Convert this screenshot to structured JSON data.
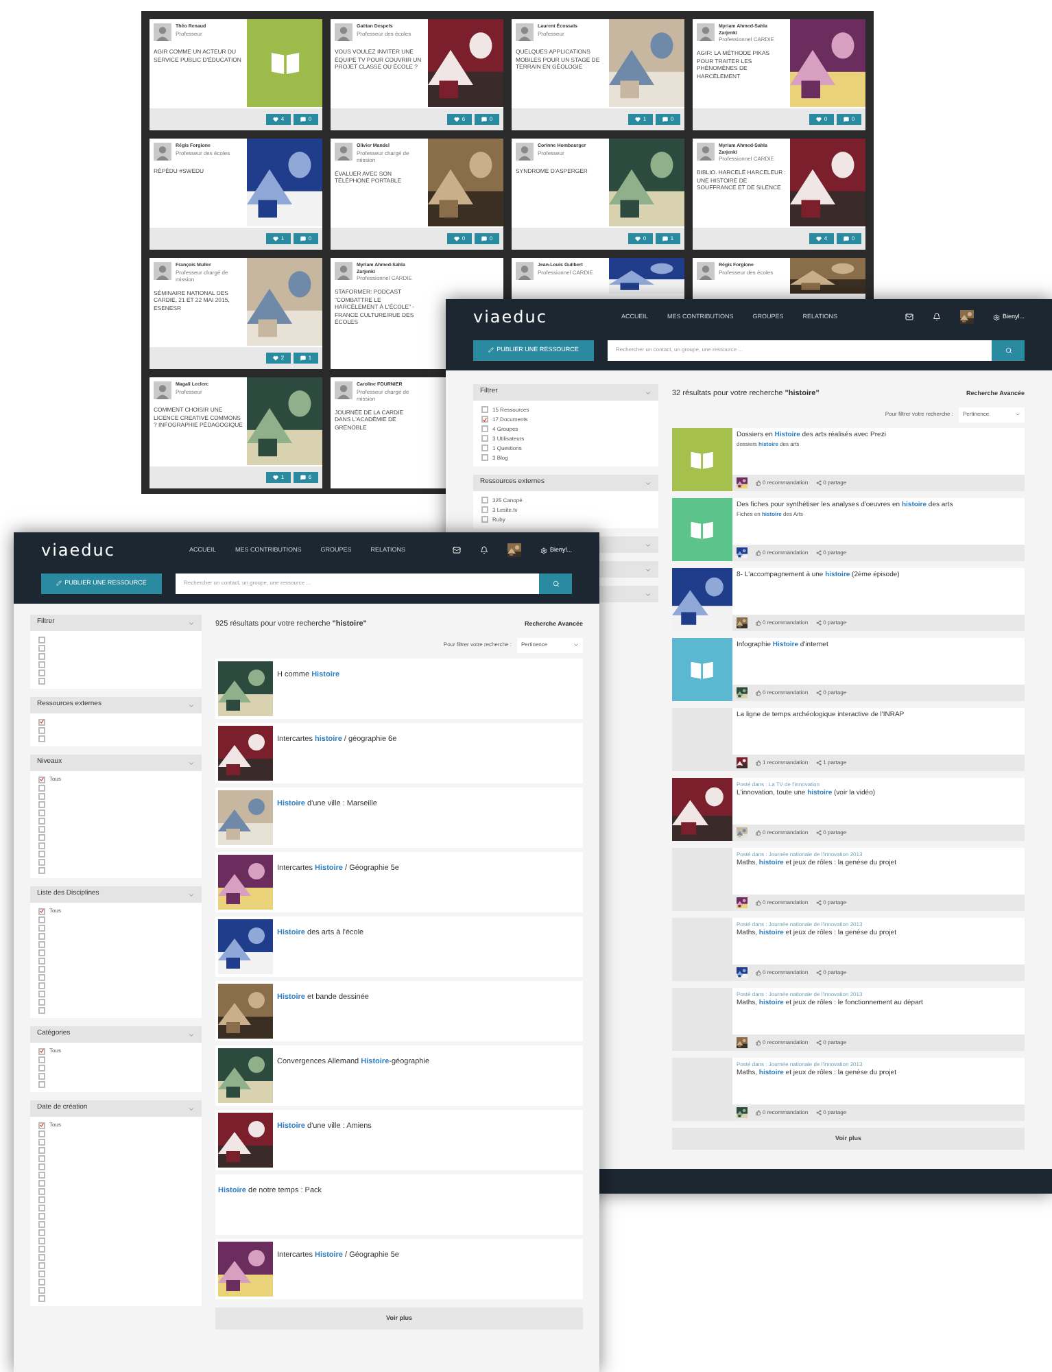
{
  "board": {
    "tiles": [
      {
        "author": "Théo Renaud",
        "role": "Professeur",
        "title": "AGIR COMME UN ACTEUR DU SERVICE PUBLIC D'ÉDUCATION",
        "thumb": {
          "kind": "book",
          "color": "#9dbb4a"
        },
        "likes": "4",
        "comments": "0"
      },
      {
        "author": "Gaëtan Despels",
        "role": "Professeur des écoles",
        "title": "VOUS VOULEZ INVITER UNE ÉQUIPE TV POUR COUVRIR UN PROJET CLASSE OU ÉCOLE ?",
        "thumb": {
          "kind": "picture"
        },
        "likes": "6",
        "comments": "0"
      },
      {
        "author": "Laurent Écossais",
        "role": "Professeur",
        "title": "QUELQUES APPLICATIONS MOBILES POUR UN STAGE DE TERRAIN EN GÉOLOGIE",
        "thumb": {
          "kind": "picture"
        },
        "likes": "1",
        "comments": "0"
      },
      {
        "author": "Myriam Ahmed-Sahla Zarjenki",
        "role": "Professionnel CARDIE",
        "title": "AGIR: LA MÉTHODE PIKAS POUR TRAITER LES PHÉNOMÈNES DE HARCÈLEMENT",
        "thumb": {
          "kind": "picture"
        },
        "likes": "0",
        "comments": "0"
      },
      {
        "author": "Régis Forgione",
        "role": "Professeur des écoles",
        "title": "RÉPÉDU #SWEDU",
        "thumb": {
          "kind": "picture"
        },
        "likes": "1",
        "comments": "0"
      },
      {
        "author": "Olivier Mandel",
        "role": "Professeur chargé de mission",
        "title": "ÉVALUER AVEC SON TÉLÉPHONE PORTABLE",
        "thumb": {
          "kind": "picture"
        },
        "likes": "0",
        "comments": "0"
      },
      {
        "author": "Corinne Hombourger",
        "role": "Professeur",
        "title": "SYNDROME D'ASPERGER",
        "thumb": {
          "kind": "picture"
        },
        "likes": "0",
        "comments": "1"
      },
      {
        "author": "Myriam Ahmed-Sahla Zarjenki",
        "role": "Professionnel CARDIE",
        "title": "BIBLIO. HARCELÉ HARCELEUR : UNE HISTOIRE DE SOUFFRANCE ET DE SILENCE",
        "thumb": {
          "kind": "picture"
        },
        "likes": "4",
        "comments": "0"
      },
      {
        "author": "François Muller",
        "role": "Professeur chargé de mission",
        "title": "SÉMINAIRE NATIONAL DES CARDIE, 21 ET 22 MAI 2015, ESENESR",
        "thumb": {
          "kind": "picture"
        },
        "likes": "2",
        "comments": "1"
      },
      {
        "author": "Myriam Ahmed-Sahla Zarjenki",
        "role": "Professionnel CARDIE",
        "title": "STAFORMER: PODCAST \"COMBATTRE LE HARCÈLEMENT À L'ÉCOLE\" - FRANCE CULTURE/RUE DES ÉCOLES"
      },
      {
        "author": "Jean-Louis Guilbert",
        "role": "Professionnel CARDIE",
        "thumb": {
          "kind": "picture"
        }
      },
      {
        "author": "Régis Forgione",
        "role": "Professeur des écoles",
        "thumb": {
          "kind": "picture"
        }
      },
      {
        "author": "Magali Leclerc",
        "role": "Professeur",
        "title": "COMMENT CHOISIR UNE LICENCE CREATIVE COMMONS ? INFOGRAPHIE PÉDAGOGIQUE",
        "thumb": {
          "kind": "picture"
        },
        "likes": "1",
        "comments": "6"
      },
      {
        "author": "Caroline FOURNIER",
        "role": "Professeur chargé de mission",
        "title": "JOURNÉE DE LA CARDIE DANS L'ACADÉMIE DE GRENOBLE"
      }
    ]
  },
  "results_page": {
    "header": {
      "logo": "viaeduc",
      "nav": [
        "ACCUEIL",
        "MES CONTRIBUTIONS",
        "GROUPES",
        "RELATIONS"
      ],
      "user": "Bienyl...",
      "publish": "PUBLIER UNE RESSOURCE",
      "search_placeholder": "Rechercher un contact, un groupe, une ressource ..."
    },
    "filter_groups": [
      {
        "title": "Filtrer",
        "items": [
          {
            "label": "15 Ressources",
            "checked": false
          },
          {
            "label": "17 Documents",
            "checked": true
          },
          {
            "label": "4 Groupes",
            "checked": false
          },
          {
            "label": "3 Utilisateurs",
            "checked": false
          },
          {
            "label": "1 Questions",
            "checked": false
          },
          {
            "label": "3 Blog",
            "checked": false
          }
        ]
      },
      {
        "title": "Ressources externes",
        "items": [
          {
            "label": "325 Canopé",
            "checked": false
          },
          {
            "label": "3 Lesite.tv",
            "checked": false
          },
          {
            "label": "Ruby",
            "checked": false
          }
        ]
      },
      {
        "expanded": false
      },
      {
        "expanded": false
      },
      {
        "expanded": false
      }
    ],
    "summary": "32 résultats pour votre recherche **\"histoire\"**",
    "advanced": "Recherche Avancée",
    "sort_label": "Pour filtrer votre recherche :",
    "sort_value": "Pertinence",
    "results": [
      {
        "title": [
          {
            "text": "Dossiers en ",
            "highlight": false
          },
          {
            "text": "Histoire",
            "highlight": true
          },
          {
            "text": " des arts réalisés avec Prezi",
            "highlight": false
          }
        ],
        "subtitle": [
          {
            "text": "dossiers ",
            "highlight": false
          },
          {
            "text": "histoire",
            "highlight": true
          },
          {
            "text": " des arts",
            "highlight": false
          }
        ],
        "thumb": {
          "kind": "book",
          "color": "#a5c04c"
        },
        "recommendations": "0 recommandation",
        "shares": "0 partage"
      },
      {
        "title": [
          {
            "text": "Des fiches pour synthétiser les analyses d'oeuvres en ",
            "highlight": false
          },
          {
            "text": "histoire",
            "highlight": true
          },
          {
            "text": " des arts",
            "highlight": false
          }
        ],
        "subtitle": [
          {
            "text": "Fiches en ",
            "highlight": false
          },
          {
            "text": "histoire",
            "highlight": true
          },
          {
            "text": " des Arts",
            "highlight": false
          }
        ],
        "thumb": {
          "kind": "book",
          "color": "#5cc48a"
        },
        "recommendations": "0 recommandation",
        "shares": "0 partage"
      },
      {
        "title": [
          {
            "text": "8- L'accompagnement à une ",
            "highlight": false
          },
          {
            "text": "histoire",
            "highlight": true
          },
          {
            "text": " (2ème épisode)",
            "highlight": false
          }
        ],
        "thumb": {
          "kind": "picture"
        },
        "recommendations": "0 recommandation",
        "shares": "0 partage"
      },
      {
        "title": [
          {
            "text": "Infographie ",
            "highlight": false
          },
          {
            "text": "Histoire",
            "highlight": true
          },
          {
            "text": " d'internet",
            "highlight": false
          }
        ],
        "thumb": {
          "kind": "book",
          "color": "#5bb8d0"
        },
        "recommendations": "0 recommandation",
        "shares": "0 partage"
      },
      {
        "title": [
          {
            "text": "La ligne de temps archéologique interactive de l'INRAP",
            "highlight": false
          }
        ],
        "thumb": {
          "kind": "empty"
        },
        "recommendations": "1 recommandation",
        "shares": "1 partage"
      },
      {
        "posted": "Posté dans : La TV de l'innovation",
        "title": [
          {
            "text": "L'innovation, toute une ",
            "highlight": false
          },
          {
            "text": "histoire",
            "highlight": true
          },
          {
            "text": " (voir la vidéo)",
            "highlight": false
          }
        ],
        "thumb": {
          "kind": "picture"
        },
        "recommendations": "0 recommandation",
        "shares": "0 partage"
      },
      {
        "posted": "Posté dans : Journée nationale de l'innovation 2013",
        "title": [
          {
            "text": "Maths, ",
            "highlight": false
          },
          {
            "text": "histoire",
            "highlight": true
          },
          {
            "text": " et jeux de rôles : la genèse du projet",
            "highlight": false
          }
        ],
        "thumb": {
          "kind": "empty"
        },
        "recommendations": "0 recommandation",
        "shares": "0 partage"
      },
      {
        "posted": "Posté dans : Journée nationale de l'innovation 2013",
        "title": [
          {
            "text": "Maths, ",
            "highlight": false
          },
          {
            "text": "histoire",
            "highlight": true
          },
          {
            "text": " et jeux de rôles : la genèse du projet",
            "highlight": false
          }
        ],
        "thumb": {
          "kind": "empty"
        },
        "recommendations": "0 recommandation",
        "shares": "0 partage"
      },
      {
        "posted": "Posté dans : Journée nationale de l'innovation 2013",
        "title": [
          {
            "text": "Maths, ",
            "highlight": false
          },
          {
            "text": "histoire",
            "highlight": true
          },
          {
            "text": " et jeux de rôles : le fonctionnement au départ",
            "highlight": false
          }
        ],
        "thumb": {
          "kind": "empty"
        },
        "recommendations": "0 recommandation",
        "shares": "0 partage"
      },
      {
        "posted": "Posté dans : Journée nationale de l'innovation 2013",
        "title": [
          {
            "text": "Maths, ",
            "highlight": false
          },
          {
            "text": "histoire",
            "highlight": true
          },
          {
            "text": " et jeux de rôles : la genèse du projet",
            "highlight": false
          }
        ],
        "thumb": {
          "kind": "empty"
        },
        "recommendations": "0 recommandation",
        "shares": "0 partage"
      }
    ],
    "more": "Voir plus"
  },
  "search_page": {
    "header": {
      "logo": "viaeduc",
      "nav": [
        "ACCUEIL",
        "MES CONTRIBUTIONS",
        "GROUPES",
        "RELATIONS"
      ],
      "user": "Bienyl...",
      "publish": "PUBLIER UNE RESSOURCE",
      "search_placeholder": "Rechercher un contact, un groupe, une ressource ..."
    },
    "filter_groups": [
      {
        "title": "Filtrer",
        "items": [
          {
            "checked": false
          },
          {
            "checked": false
          },
          {
            "checked": false
          },
          {
            "checked": false
          },
          {
            "checked": false
          },
          {
            "checked": false
          }
        ]
      },
      {
        "title": "Ressources externes",
        "items": [
          {
            "checked": true
          },
          {
            "checked": false
          },
          {
            "checked": false
          }
        ]
      },
      {
        "title": "Niveaux",
        "items": [
          {
            "label": "Tous",
            "checked": true
          },
          {
            "checked": false
          },
          {
            "checked": false
          },
          {
            "checked": false
          },
          {
            "checked": false
          },
          {
            "checked": false
          },
          {
            "checked": false
          },
          {
            "checked": false
          },
          {
            "checked": false
          },
          {
            "checked": false
          },
          {
            "checked": false
          },
          {
            "checked": false
          }
        ]
      },
      {
        "title": "Liste des Disciplines",
        "items": [
          {
            "label": "Tous",
            "checked": true
          },
          {
            "checked": false
          },
          {
            "checked": false
          },
          {
            "checked": false
          },
          {
            "checked": false
          },
          {
            "checked": false
          },
          {
            "checked": false
          },
          {
            "checked": false
          },
          {
            "checked": false
          },
          {
            "checked": false
          },
          {
            "checked": false
          },
          {
            "checked": false
          },
          {
            "checked": false
          }
        ]
      },
      {
        "title": "Catégories",
        "items": [
          {
            "label": "Tous",
            "checked": true
          },
          {
            "checked": false
          },
          {
            "checked": false
          },
          {
            "checked": false
          },
          {
            "checked": false
          }
        ]
      },
      {
        "title": "Date de création",
        "items": [
          {
            "label": "Tous",
            "checked": true
          },
          {
            "checked": false
          },
          {
            "checked": false
          },
          {
            "checked": false
          },
          {
            "checked": false
          },
          {
            "checked": false
          },
          {
            "checked": false
          },
          {
            "checked": false
          },
          {
            "checked": false
          },
          {
            "checked": false
          },
          {
            "checked": false
          },
          {
            "checked": false
          },
          {
            "checked": false
          },
          {
            "checked": false
          },
          {
            "checked": false
          },
          {
            "checked": false
          },
          {
            "checked": false
          },
          {
            "checked": false
          },
          {
            "checked": false
          },
          {
            "checked": false
          },
          {
            "checked": false
          },
          {
            "checked": false
          }
        ]
      }
    ],
    "summary": "925 résultats pour votre recherche **\"histoire\"**",
    "advanced": "Recherche Avancée",
    "sort_label": "Pour filtrer votre recherche :",
    "sort_value": "Pertinence",
    "results": [
      {
        "title": [
          {
            "text": "H comme ",
            "highlight": false
          },
          {
            "text": "Histoire",
            "highlight": true
          }
        ],
        "thumb": {
          "kind": "picture"
        }
      },
      {
        "title": [
          {
            "text": "Intercartes ",
            "highlight": false
          },
          {
            "text": "histoire",
            "highlight": true
          },
          {
            "text": " / géographie 6e",
            "highlight": false
          }
        ],
        "thumb": {
          "kind": "picture"
        }
      },
      {
        "title": [
          {
            "text": "Histoire",
            "highlight": true
          },
          {
            "text": " d'une ville : Marseille",
            "highlight": false
          }
        ],
        "thumb": {
          "kind": "picture"
        }
      },
      {
        "title": [
          {
            "text": "Intercartes ",
            "highlight": false
          },
          {
            "text": "Histoire",
            "highlight": true
          },
          {
            "text": " / Géographie 5e",
            "highlight": false
          }
        ],
        "thumb": {
          "kind": "picture"
        }
      },
      {
        "title": [
          {
            "text": "Histoire",
            "highlight": true
          },
          {
            "text": " des arts à l'école",
            "highlight": false
          }
        ],
        "thumb": {
          "kind": "picture"
        }
      },
      {
        "title": [
          {
            "text": "Histoire",
            "highlight": true
          },
          {
            "text": " et bande dessinée",
            "highlight": false
          }
        ],
        "thumb": {
          "kind": "picture"
        }
      },
      {
        "title": [
          {
            "text": "Convergences Allemand ",
            "highlight": false
          },
          {
            "text": "Histoire",
            "highlight": true
          },
          {
            "text": "-géographie",
            "highlight": false
          }
        ],
        "thumb": {
          "kind": "picture"
        }
      },
      {
        "title": [
          {
            "text": "Histoire",
            "highlight": true
          },
          {
            "text": " d'une ville : Amiens",
            "highlight": false
          }
        ],
        "thumb": {
          "kind": "picture"
        }
      },
      {
        "title": [
          {
            "text": "Histoire",
            "highlight": true
          },
          {
            "text": " de notre temps : Pack",
            "highlight": false
          }
        ],
        "thumb": {
          "kind": "none"
        }
      },
      {
        "title": [
          {
            "text": "Intercartes ",
            "highlight": false
          },
          {
            "text": "Histoire",
            "highlight": true
          },
          {
            "text": " / Géographie 5e",
            "highlight": false
          }
        ],
        "thumb": {
          "kind": "picture"
        }
      }
    ],
    "more": "Voir plus"
  }
}
